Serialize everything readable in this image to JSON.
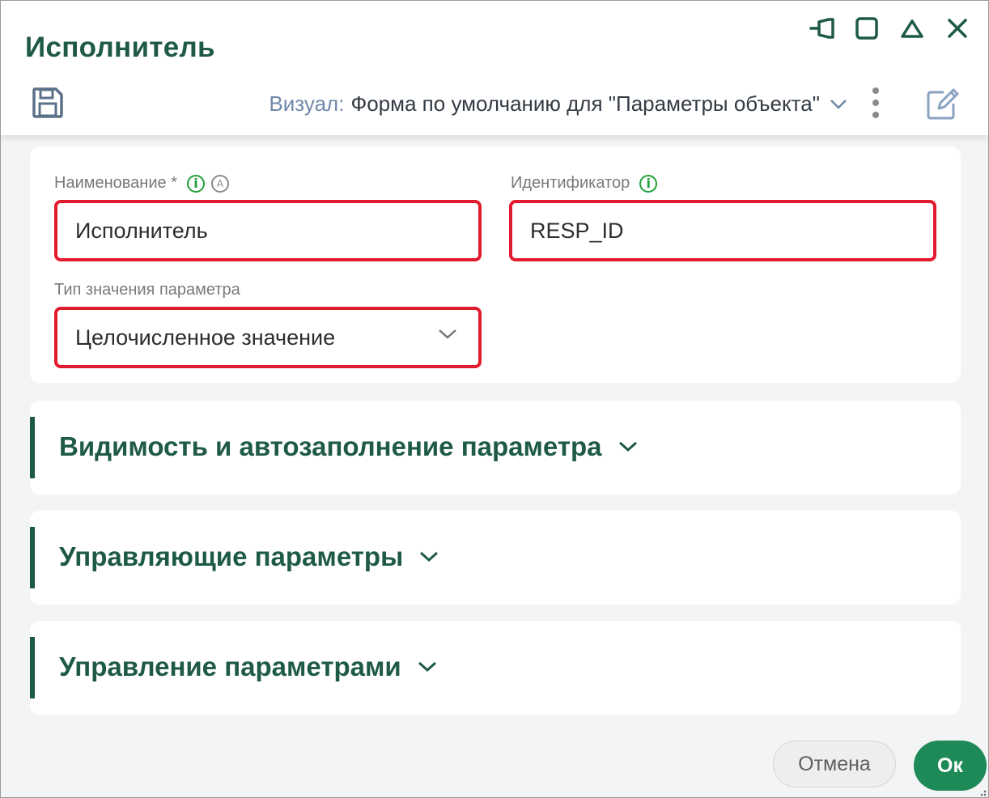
{
  "window": {
    "title": "Исполнитель"
  },
  "toolbar": {
    "visual_label": "Визуал:",
    "visual_value": "Форма по умолчанию для \"Параметры объекта\""
  },
  "form": {
    "name": {
      "label": "Наименование *",
      "value": "Исполнитель",
      "a_badge": "A"
    },
    "identifier": {
      "label": "Идентификатор",
      "value": "RESP_ID"
    },
    "value_type": {
      "label": "Тип значения параметра",
      "value": "Целочисленное значение"
    },
    "info_glyph": "i"
  },
  "sections": [
    {
      "title": "Видимость и автозаполнение параметра"
    },
    {
      "title": "Управляющие параметры"
    },
    {
      "title": "Управление параметрами"
    }
  ],
  "footer": {
    "cancel_label": "Отмена",
    "ok_label": "Ок"
  },
  "colors": {
    "accent_dark_green": "#1e5a45",
    "ok_button": "#1d8a57",
    "highlight_red": "#e31b2e",
    "info_green": "#22a03a"
  }
}
